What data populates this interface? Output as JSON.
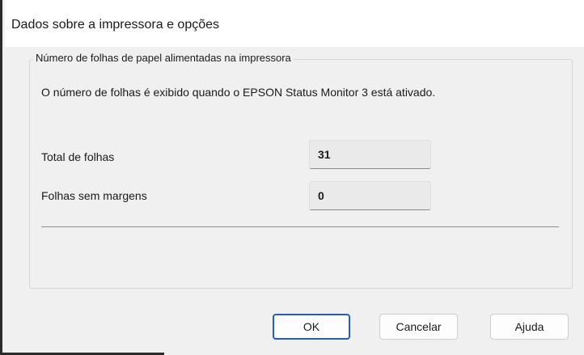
{
  "dialog": {
    "title": "Dados sobre a impressora e opções"
  },
  "group": {
    "legend": "Número de folhas de papel alimentadas na impressora",
    "info": "O número de folhas é exibido quando o EPSON Status Monitor 3 está ativado.",
    "fields": [
      {
        "label": "Total de folhas",
        "value": "31"
      },
      {
        "label": "Folhas sem margens",
        "value": "0"
      }
    ]
  },
  "buttons": {
    "ok": "OK",
    "cancel": "Cancelar",
    "help": "Ajuda"
  }
}
